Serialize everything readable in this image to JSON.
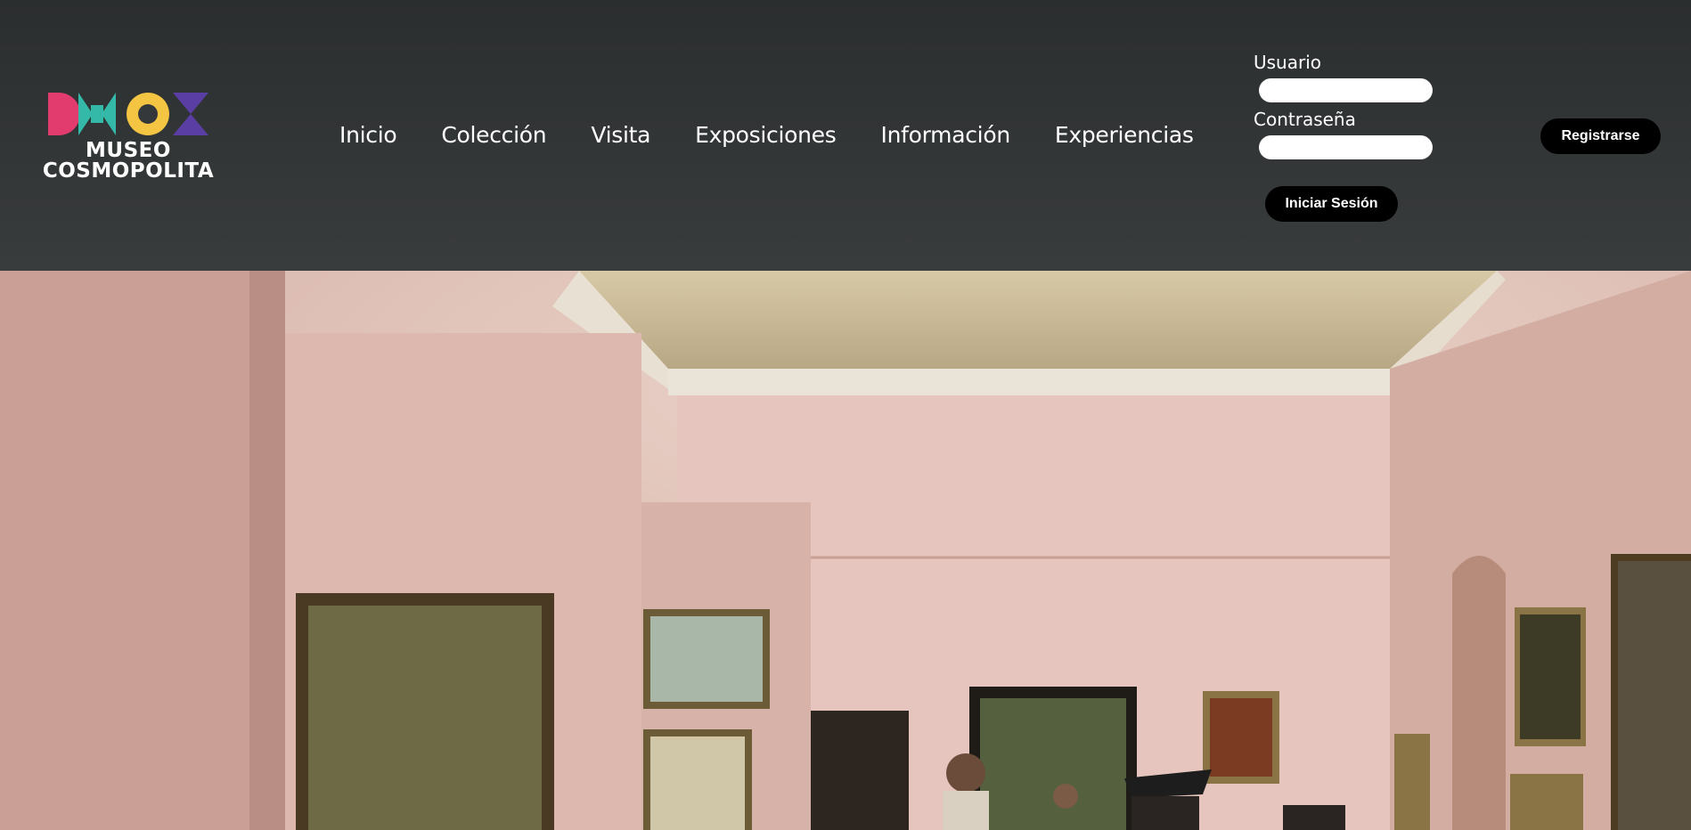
{
  "brand": {
    "name_line1": "MUSEO",
    "name_line2": "COSMOPOLITA"
  },
  "nav": {
    "items": [
      {
        "label": "Inicio"
      },
      {
        "label": "Colección"
      },
      {
        "label": "Visita"
      },
      {
        "label": "Exposiciones"
      },
      {
        "label": "Información"
      },
      {
        "label": "Experiencias"
      }
    ]
  },
  "login": {
    "user_label": "Usuario",
    "user_value": "",
    "user_placeholder": "",
    "password_label": "Contraseña",
    "password_value": "",
    "password_placeholder": "",
    "submit_label": "Iniciar Sesión"
  },
  "register": {
    "label": "Registrarse"
  },
  "colors": {
    "header_bg": "#35383a",
    "button_bg": "#000000",
    "logo_pink": "#e23c6f",
    "logo_teal": "#34b8a8",
    "logo_yellow": "#f4c542",
    "logo_purple": "#5b3ea4"
  },
  "hero": {
    "image": "museum-gallery-photo"
  }
}
